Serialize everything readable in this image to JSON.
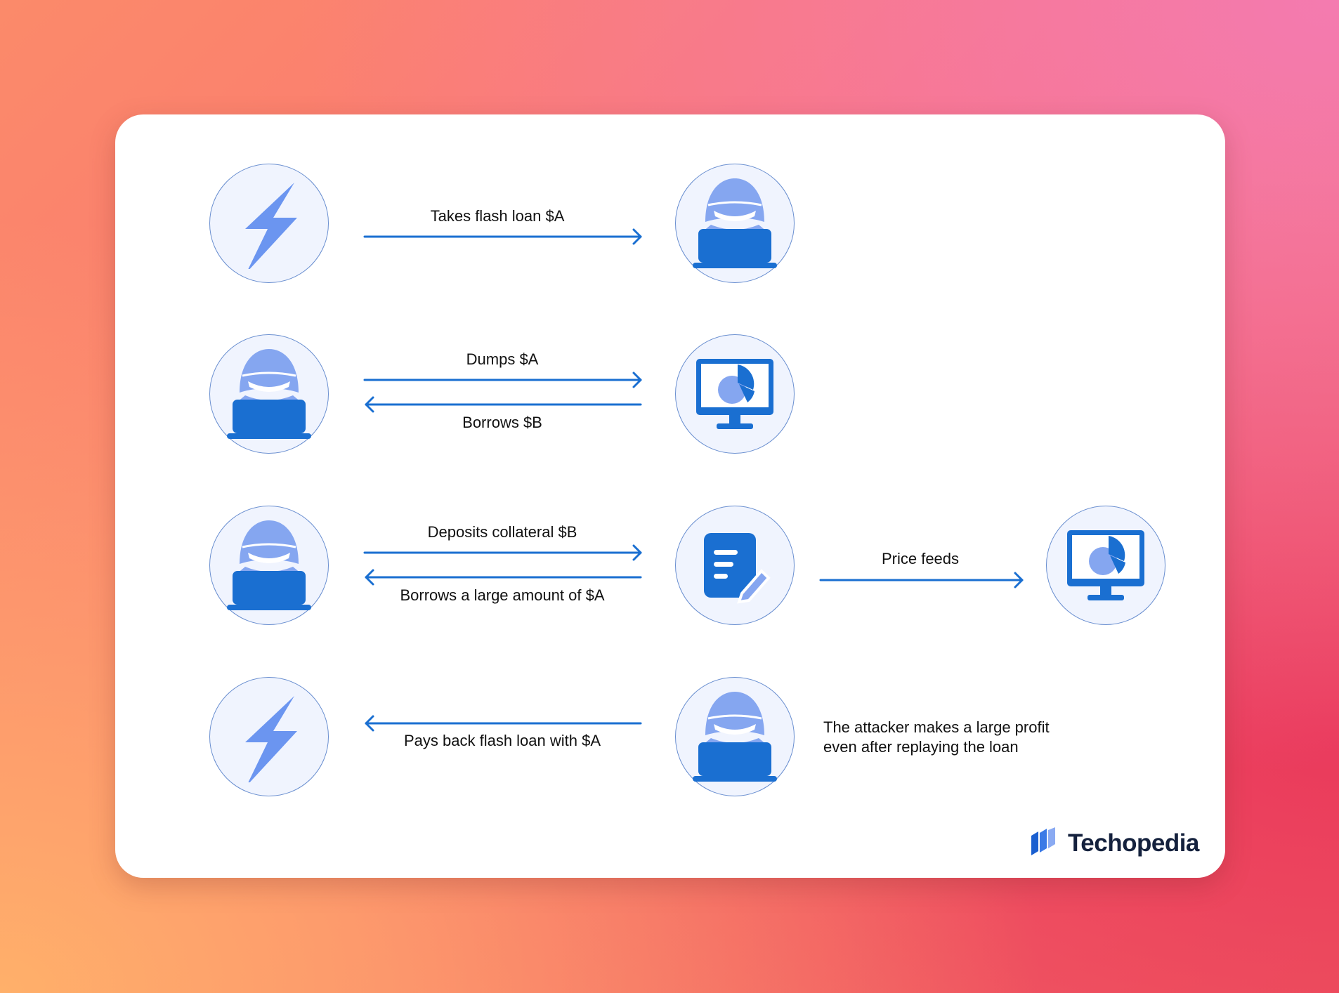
{
  "diagram": {
    "row1": {
      "arrow_right": "Takes flash loan $A"
    },
    "row2": {
      "arrow_right": "Dumps $A",
      "arrow_left": "Borrows $B"
    },
    "row3": {
      "arrow_right": "Deposits collateral $B",
      "arrow_left": "Borrows a large amount of $A",
      "arrow_feed": "Price feeds"
    },
    "row4": {
      "arrow_left": "Pays back flash loan with $A",
      "note_line1": "The attacker makes a large profit",
      "note_line2": "even after replaying the loan"
    }
  },
  "brand": {
    "name": "Techopedia"
  },
  "icons": {
    "flash_loan": "lightning-icon",
    "attacker": "hacker-laptop-icon",
    "exchange": "monitor-pie-chart-icon",
    "lending": "document-edit-icon",
    "oracle": "monitor-pie-chart-icon"
  },
  "colors": {
    "icon_primary": "#1a6fd1",
    "icon_secondary": "#7fa2f2",
    "node_fill": "#f0f4fe",
    "node_border": "#6a8fd0",
    "arrow": "#1a6fd1",
    "brand_text": "#14213d"
  }
}
